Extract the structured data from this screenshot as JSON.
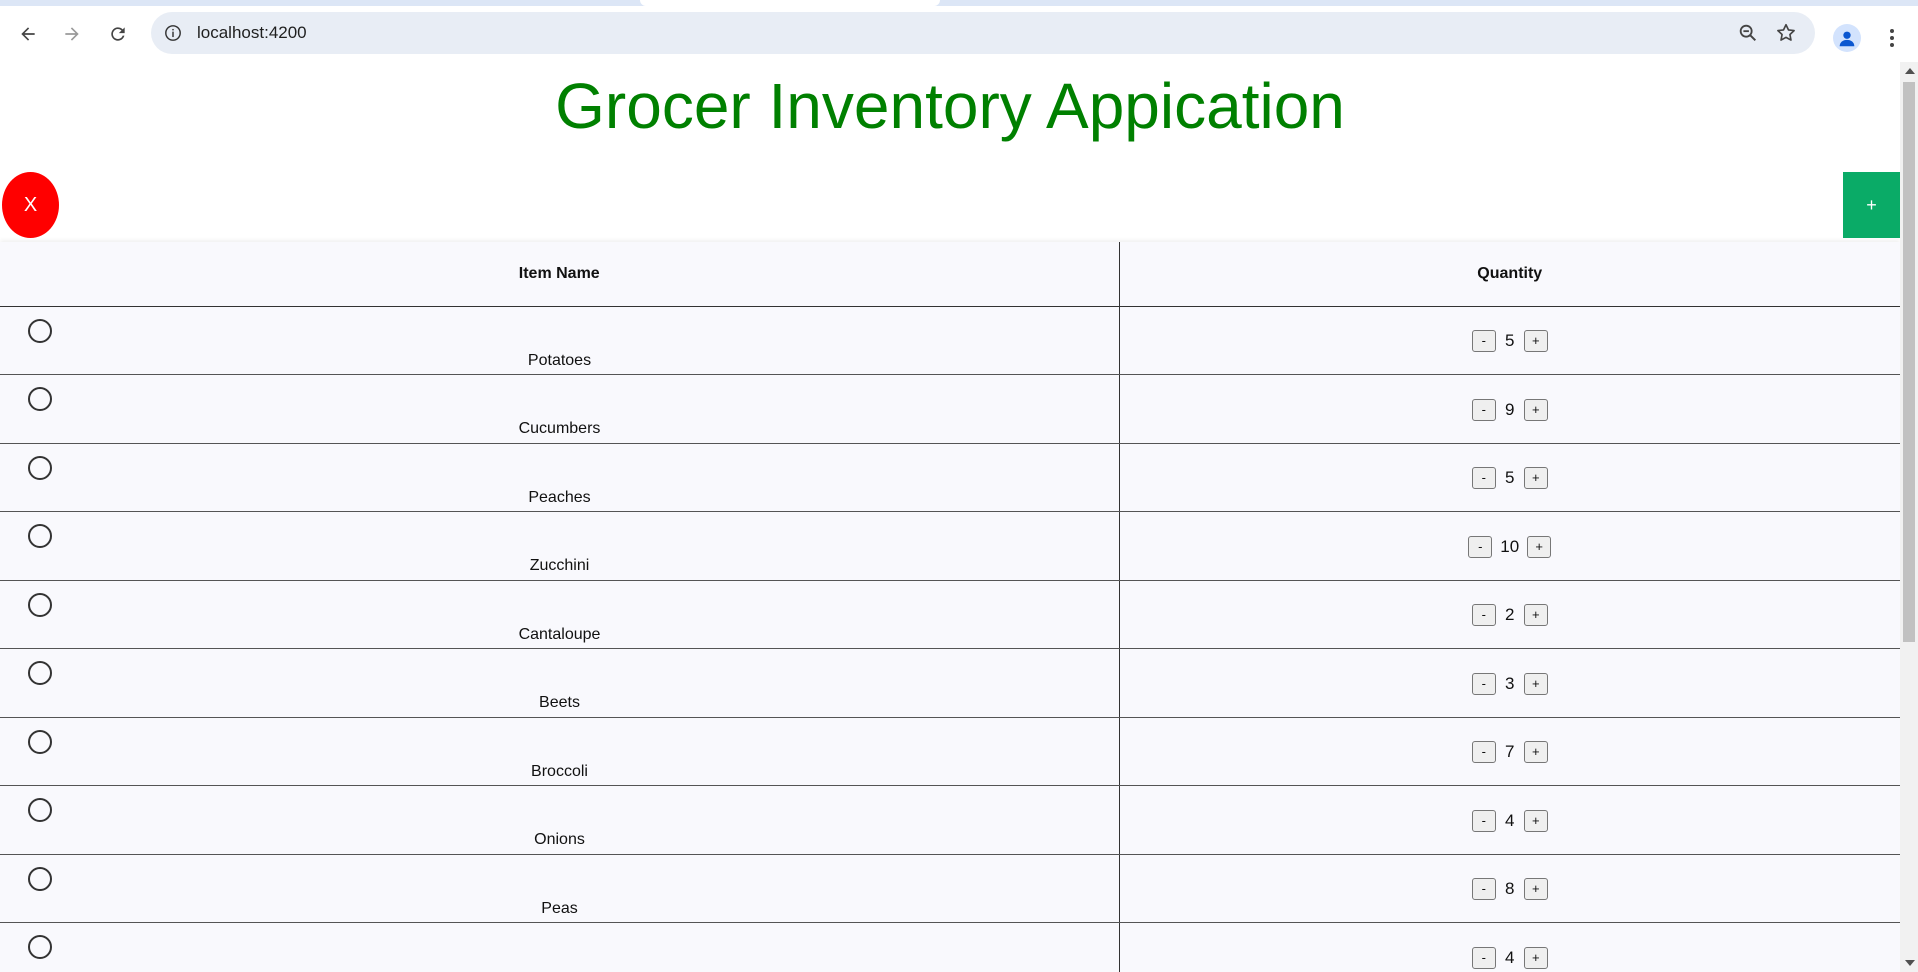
{
  "browser": {
    "url": "localhost:4200"
  },
  "app": {
    "title": "Grocer Inventory Appication",
    "delete_label": "X",
    "add_label": "+"
  },
  "table": {
    "headers": {
      "name": "Item Name",
      "quantity": "Quantity"
    },
    "decrement_label": "-",
    "increment_label": "+",
    "rows": [
      {
        "name": "Potatoes",
        "quantity": "5"
      },
      {
        "name": "Cucumbers",
        "quantity": "9"
      },
      {
        "name": "Peaches",
        "quantity": "5"
      },
      {
        "name": "Zucchini",
        "quantity": "10"
      },
      {
        "name": "Cantaloupe",
        "quantity": "2"
      },
      {
        "name": "Beets",
        "quantity": "3"
      },
      {
        "name": "Broccoli",
        "quantity": "7"
      },
      {
        "name": "Onions",
        "quantity": "4"
      },
      {
        "name": "Peas",
        "quantity": "8"
      },
      {
        "name": "",
        "quantity": "4"
      }
    ]
  },
  "colors": {
    "title": "#008000",
    "delete": "#ff0000",
    "add": "#0aab67"
  }
}
